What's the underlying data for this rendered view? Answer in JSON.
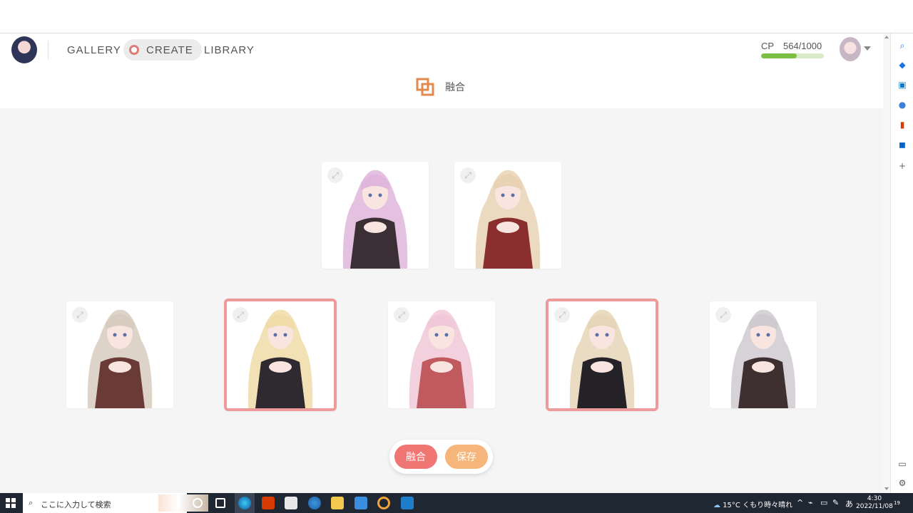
{
  "nav": {
    "gallery": "GALLERY",
    "create": "CREATE",
    "library": "LIBRARY"
  },
  "cp": {
    "label": "CP",
    "value": "564/1000",
    "fraction": 0.564,
    "bar_color": "#7bbf43"
  },
  "section": {
    "title": "融合",
    "icon": "fusion-icon"
  },
  "parents": [
    {
      "hair": "#e0b6dc",
      "dress": "#3b2f35",
      "skin": "#f8e5df"
    },
    {
      "hair": "#e7d3b4",
      "dress": "#8b2e2e",
      "skin": "#f8e5df"
    }
  ],
  "offspring": [
    {
      "hair": "#d8cbbf",
      "dress": "#6a3a36",
      "skin": "#f8e5df",
      "selected": false
    },
    {
      "hair": "#efdca8",
      "dress": "#2f2a2f",
      "skin": "#f8e5df",
      "selected": true
    },
    {
      "hair": "#f1c8d8",
      "dress": "#c05a5e",
      "skin": "#f8e5df",
      "selected": false
    },
    {
      "hair": "#e5d6b8",
      "dress": "#262328",
      "skin": "#f8e5df",
      "selected": true
    },
    {
      "hair": "#cfcad0",
      "dress": "#3e3031",
      "skin": "#f8e5df",
      "selected": false
    }
  ],
  "actions": {
    "fuse_label": "融合",
    "save_label": "保存"
  },
  "taskbar": {
    "search_placeholder": "ここに入力して検索",
    "weather": "15°C くもり時々晴れ",
    "ime": "あ",
    "time": "4:30",
    "date": "2022/11/08",
    "notification_count": "19"
  }
}
